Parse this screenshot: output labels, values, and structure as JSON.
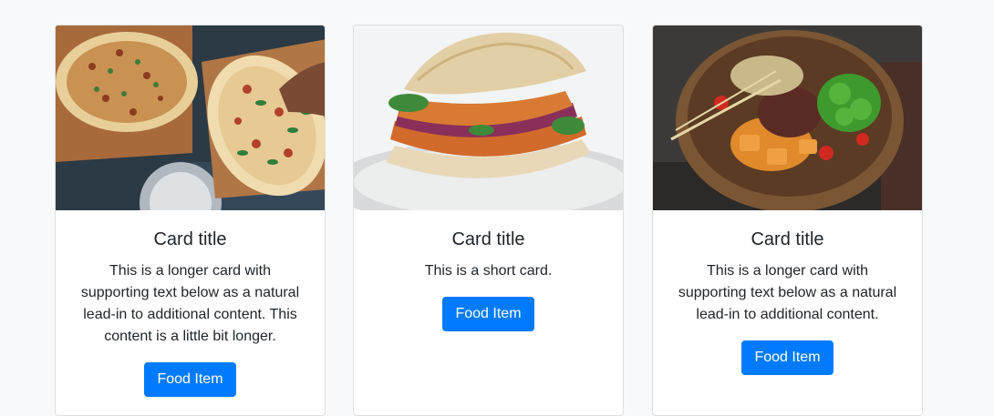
{
  "colors": {
    "page_bg": "#f8f9fa",
    "card_bg": "#ffffff",
    "button_bg": "#007bff",
    "button_text": "#ffffff"
  },
  "cards": [
    {
      "image": "pizza-flatbread-photo",
      "title": "Card title",
      "text": "This is a longer card with supporting text below as a natural lead-in to additional content. This content is a little bit longer.",
      "button_label": "Food Item"
    },
    {
      "image": "sandwich-photo",
      "title": "Card title",
      "text": "This is a short card.",
      "button_label": "Food Item"
    },
    {
      "image": "salad-bowl-photo",
      "title": "Card title",
      "text": "This is a longer card with supporting text below as a natural lead-in to additional content.",
      "button_label": "Food Item"
    }
  ]
}
